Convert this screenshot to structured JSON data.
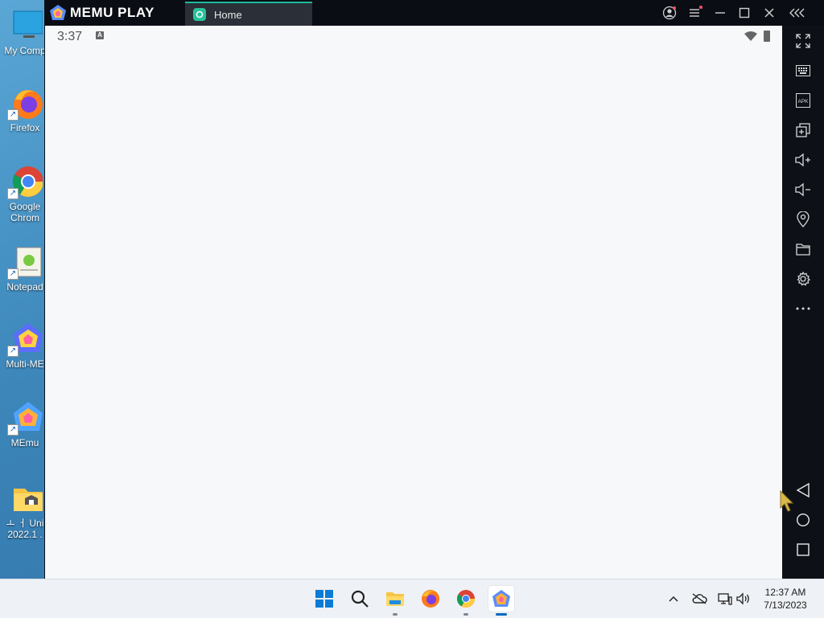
{
  "desktop": {
    "icons": [
      {
        "label": "My Comp",
        "name": "desktop-icon-my-computer",
        "icon": "monitor-icon"
      },
      {
        "label": "Firefox",
        "name": "desktop-icon-firefox",
        "icon": "firefox-icon"
      },
      {
        "label": "Google",
        "label2": "Chrom",
        "name": "desktop-icon-google-chrome",
        "icon": "chrome-icon"
      },
      {
        "label": "Notepad",
        "name": "desktop-icon-notepad",
        "icon": "notepad-icon"
      },
      {
        "label": "Multi-ME",
        "name": "desktop-icon-multi-memu",
        "icon": "multi-memu-icon"
      },
      {
        "label": "MEmu",
        "name": "desktop-icon-memu",
        "icon": "memu-icon"
      },
      {
        "label": "ㅗ ㅓ Uni",
        "label2": "2022.1 .",
        "name": "desktop-icon-folder",
        "icon": "folder-icon"
      }
    ]
  },
  "emulator": {
    "brand": "MEMU PLAY",
    "tab_label": "Home",
    "colors": {
      "accent": "#1abc9c",
      "titlebar": "#0a0e14",
      "screen": "#f7f8fa"
    },
    "status": {
      "time": "3:37",
      "notification": "A"
    },
    "sidebar": [
      "fullscreen-icon",
      "keyboard-icon",
      "apk-icon",
      "multi-window-icon",
      "volume-up-icon",
      "volume-down-icon",
      "location-icon",
      "folder-icon",
      "settings-icon",
      "more-icon"
    ],
    "sidebar_apk_text": "APK",
    "nav": [
      "back-icon",
      "home-icon",
      "recents-icon"
    ]
  },
  "taskbar": {
    "apps": [
      "start-icon",
      "search-icon",
      "file-explorer-icon",
      "firefox-icon",
      "chrome-icon",
      "memu-icon"
    ],
    "clock_time": "12:37 AM",
    "clock_date": "7/13/2023"
  }
}
